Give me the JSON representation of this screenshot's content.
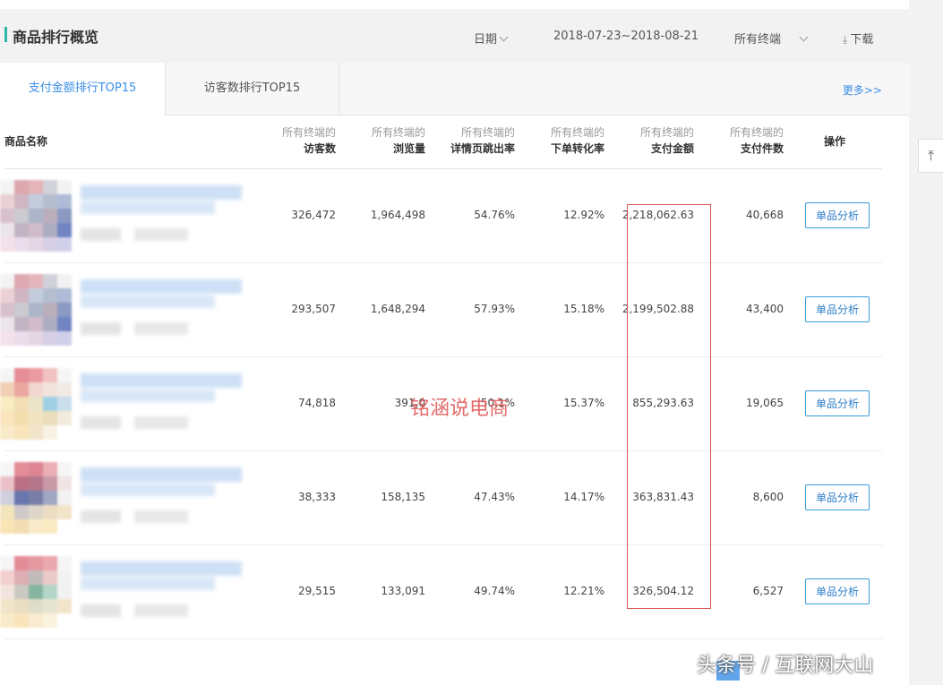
{
  "header": {
    "title": "商品排行概览",
    "date_label": "日期",
    "date_range": "2018-07-23~2018-08-21",
    "terminal_label": "所有终端",
    "download_label": "下载"
  },
  "tabs": [
    {
      "label": "支付金额排行TOP15",
      "active": true
    },
    {
      "label": "访客数排行TOP15",
      "active": false
    }
  ],
  "more_label": "更多>>",
  "table": {
    "name_header": "商品名称",
    "columns": [
      {
        "prefix": "所有终端的",
        "label": "访客数"
      },
      {
        "prefix": "所有终端的",
        "label": "浏览量"
      },
      {
        "prefix": "所有终端的",
        "label": "详情页跳出率"
      },
      {
        "prefix": "所有终端的",
        "label": "下单转化率"
      },
      {
        "prefix": "所有终端的",
        "label": "支付金额"
      },
      {
        "prefix": "所有终端的",
        "label": "支付件数"
      }
    ],
    "op_header": "操作",
    "rows": [
      {
        "cells": [
          "326,472",
          "1,964,498",
          "54.76%",
          "12.92%",
          "2,218,062.63",
          "40,668"
        ],
        "action": "单品分析"
      },
      {
        "cells": [
          "293,507",
          "1,648,294",
          "57.93%",
          "15.18%",
          "2,199,502.88",
          "43,400"
        ],
        "action": "单品分析"
      },
      {
        "cells": [
          "74,818",
          "391,0",
          "50.1%",
          "15.37%",
          "855,293.63",
          "19,065"
        ],
        "action": "单品分析"
      },
      {
        "cells": [
          "38,333",
          "158,135",
          "47.43%",
          "14.17%",
          "363,831.43",
          "8,600"
        ],
        "action": "单品分析"
      },
      {
        "cells": [
          "29,515",
          "133,091",
          "49.74%",
          "12.21%",
          "326,504.12",
          "6,527"
        ],
        "action": "单品分析"
      }
    ]
  },
  "watermarks": {
    "center": "铭涵说电商",
    "bottom_right": "头条号 / 互联网大山"
  },
  "to_top_icon": "arrow-up-to-top-icon",
  "colors": {
    "accent": "#3a8ee6",
    "title_bar": "#2bb8aa",
    "highlight_border": "#d9534f"
  }
}
